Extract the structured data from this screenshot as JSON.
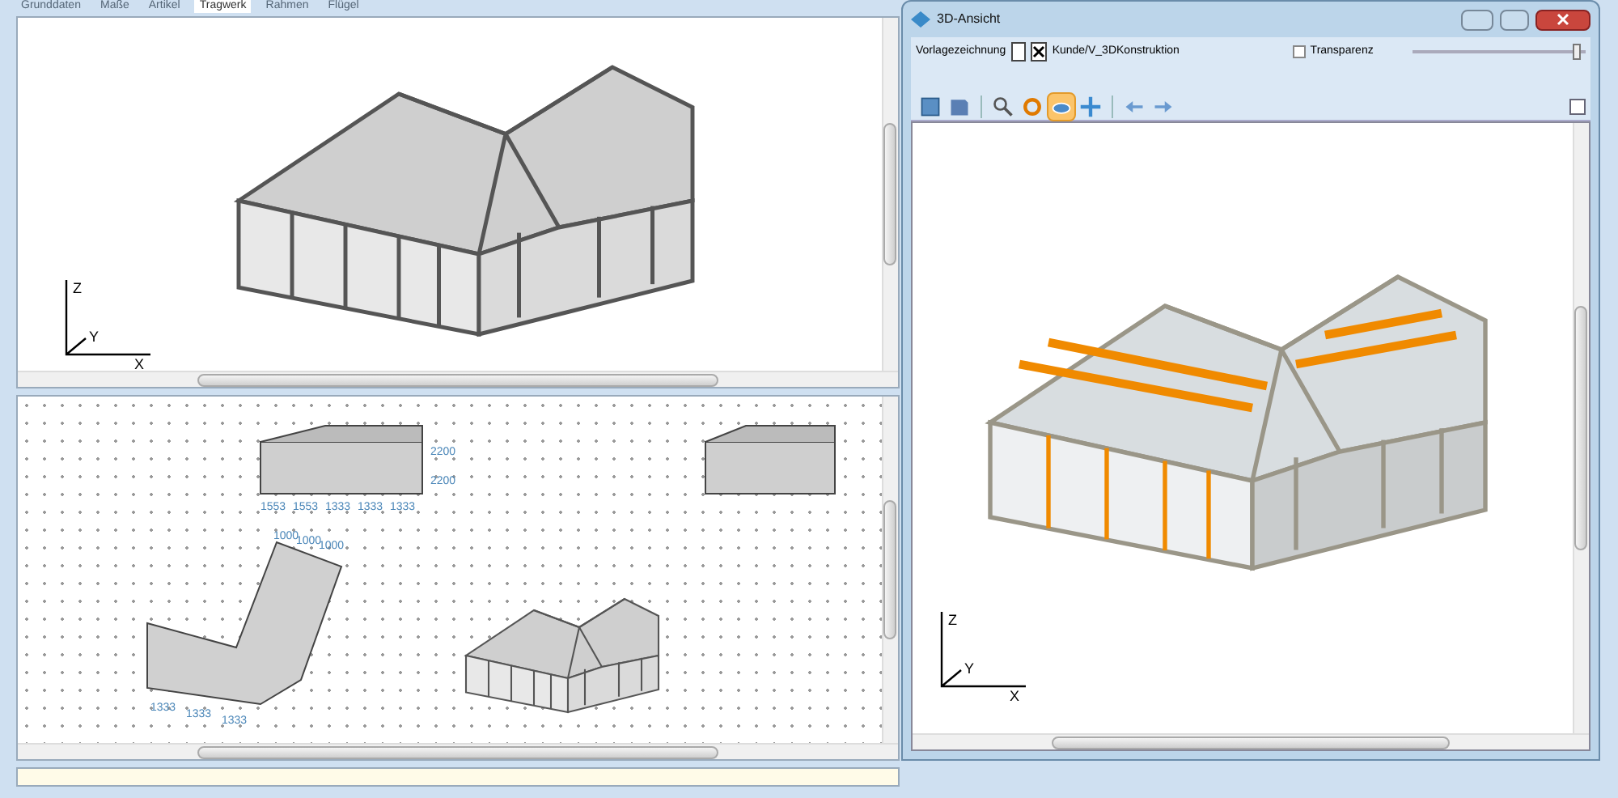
{
  "tabs": [
    {
      "label": "Grunddaten",
      "selected": false
    },
    {
      "label": "Maße",
      "selected": false
    },
    {
      "label": "Artikel",
      "selected": false
    },
    {
      "label": "Tragwerk",
      "selected": true
    },
    {
      "label": "Rahmen",
      "selected": false
    },
    {
      "label": "Flügel",
      "selected": false
    }
  ],
  "top_view": {
    "axes": {
      "z": "Z",
      "y": "Y",
      "x": "X"
    }
  },
  "plan_view": {
    "front_dims": [
      "1553",
      "1553",
      "1333",
      "1333",
      "1333"
    ],
    "height_dims": [
      "2200",
      "2200"
    ],
    "plan_dims": [
      "1000",
      "1000",
      "1000",
      "1333",
      "1333",
      "1333"
    ]
  },
  "viewer": {
    "title": "3D-Ansicht",
    "template_label": "Vorlagezeichnung",
    "template_path": "Kunde/V_3DKonstruktion",
    "transparency": {
      "label": "Transparenz",
      "checked": false
    },
    "slider": {
      "level": 0.95
    },
    "toolbar": [
      {
        "kind": "fit",
        "selected": false
      },
      {
        "kind": "save",
        "selected": false
      },
      {
        "kind": "sep"
      },
      {
        "kind": "zoom",
        "selected": false
      },
      {
        "kind": "rotate",
        "selected": false
      },
      {
        "kind": "orbit",
        "selected": true
      },
      {
        "kind": "pan",
        "selected": false
      },
      {
        "kind": "sep"
      },
      {
        "kind": "back",
        "selected": false
      },
      {
        "kind": "forward",
        "selected": false
      }
    ],
    "axes": {
      "z": "Z",
      "y": "Y",
      "x": "X"
    }
  }
}
